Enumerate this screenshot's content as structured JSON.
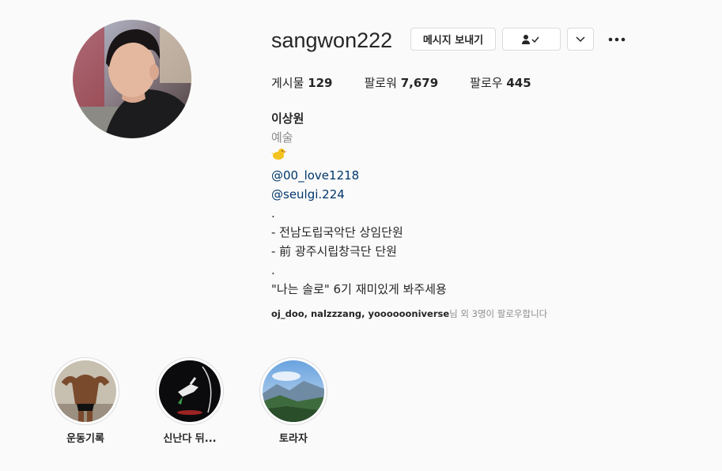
{
  "profile": {
    "username": "sangwon222",
    "avatar_alt": "profile-photo"
  },
  "actions": {
    "message_label": "메시지 보내기",
    "follow_icon": "person-check-icon",
    "suggest_icon": "chevron-down-icon",
    "more_icon": "more-horizontal-icon"
  },
  "stats": {
    "posts_label": "게시물",
    "posts_count": "129",
    "followers_label": "팔로워",
    "followers_count": "7,679",
    "following_label": "팔로우",
    "following_count": "445"
  },
  "bio": {
    "full_name": "이상원",
    "category": "예술",
    "emoji": "🐤",
    "mention_1": "@00_love1218",
    "mention_2": "@seulgi.224",
    "dot_1": ".",
    "line_1": "- 전남도립국악단 상임단원",
    "line_2": "- 前 광주시립창극단 단원",
    "dot_2": ".",
    "line_3": "\"나는 솔로\" 6기 재미있게 봐주세용"
  },
  "followed_by": {
    "names": "oj_doo, nalzzzang, yooooooniverse",
    "suffix": "님 외 3명이 팔로우합니다"
  },
  "highlights": [
    {
      "label": "운동기록"
    },
    {
      "label": "신난다 뒤..."
    },
    {
      "label": "토라자"
    }
  ],
  "colors": {
    "background": "#fafafa",
    "border": "#dbdbdb",
    "secondary_text": "#8e8e8e",
    "link": "#00376b"
  }
}
